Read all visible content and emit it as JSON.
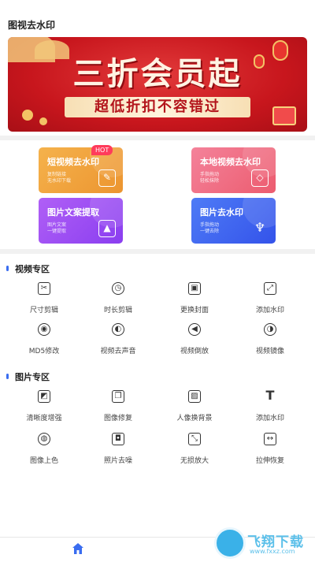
{
  "app": {
    "title": "图视去水印"
  },
  "banner": {
    "headline": "三折会员起",
    "subline": "超低折扣不容错过"
  },
  "features": [
    {
      "title": "短视频去水印",
      "sub1": "复制链接",
      "sub2": "无水印下载",
      "icon": "magic-wand-icon",
      "color": "#f0a43e"
    },
    {
      "title": "本地视频去水印",
      "sub1": "手指拖动",
      "sub2": "轻松抹除",
      "icon": "eraser-icon",
      "color": "#f06a7d"
    },
    {
      "title": "图片文案提取",
      "sub1": "图片文案",
      "sub2": "一键提取",
      "icon": "image-icon",
      "color": "#9b4ff2"
    },
    {
      "title": "图片去水印",
      "sub1": "手指拖动",
      "sub2": "一键去除",
      "icon": "pen-nib-icon",
      "color": "#3e66f2"
    }
  ],
  "hot_badge": "HOT",
  "video_section": {
    "title": "视频专区",
    "tools": [
      {
        "label": "尺寸剪辑",
        "icon": "scissors-icon"
      },
      {
        "label": "时长剪辑",
        "icon": "clock-icon"
      },
      {
        "label": "更换封面",
        "icon": "cover-image-icon"
      },
      {
        "label": "添加水印",
        "icon": "add-watermark-icon"
      },
      {
        "label": "MD5修改",
        "icon": "lock-file-icon"
      },
      {
        "label": "视频去声音",
        "icon": "mute-icon"
      },
      {
        "label": "视频倒放",
        "icon": "rewind-icon"
      },
      {
        "label": "视频镜像",
        "icon": "mirror-icon"
      }
    ]
  },
  "image_section": {
    "title": "图片专区",
    "tools": [
      {
        "label": "清晰度增强",
        "icon": "hd-icon"
      },
      {
        "label": "图像修复",
        "icon": "layers-icon"
      },
      {
        "label": "人像换背景",
        "icon": "portrait-bg-icon"
      },
      {
        "label": "添加水印",
        "icon": "text-t-icon"
      },
      {
        "label": "图像上色",
        "icon": "palette-icon"
      },
      {
        "label": "照片去噪",
        "icon": "camera-icon"
      },
      {
        "label": "无损放大",
        "icon": "enlarge-icon"
      },
      {
        "label": "拉伸恢复",
        "icon": "stretch-icon"
      }
    ]
  },
  "bottom_nav": {
    "home_icon": "home-icon",
    "accent": "#3a6df0"
  },
  "watermark": {
    "text": "飞翔下载",
    "url": "www.fxxz.com"
  }
}
